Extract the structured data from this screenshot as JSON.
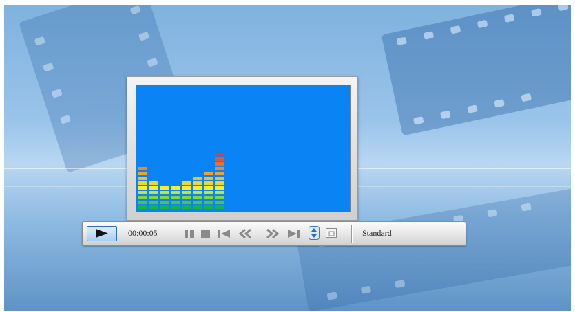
{
  "player": {
    "time": "00:00:05",
    "mode": "Standard"
  },
  "controls": [
    {
      "name": "pause-button",
      "icon": "pause-icon"
    },
    {
      "name": "stop-button",
      "icon": "stop-icon"
    },
    {
      "name": "previous-button",
      "icon": "skip-back-icon"
    },
    {
      "name": "rewind-button",
      "icon": "rewind-icon"
    },
    {
      "name": "fast-forward-button",
      "icon": "fast-forward-icon"
    },
    {
      "name": "next-button",
      "icon": "skip-forward-icon"
    },
    {
      "name": "up-down-button",
      "icon": "up-down-arrows-icon"
    },
    {
      "name": "window-button",
      "icon": "window-icon"
    }
  ],
  "visualizer": {
    "bars": [
      9,
      6,
      5,
      5,
      6,
      7,
      8,
      12
    ],
    "max_level": 12,
    "colors": {
      "low": "#16b63c",
      "mid": "#f4f32a",
      "high": "#ea3b2c",
      "screen": "#0a84f5"
    }
  }
}
